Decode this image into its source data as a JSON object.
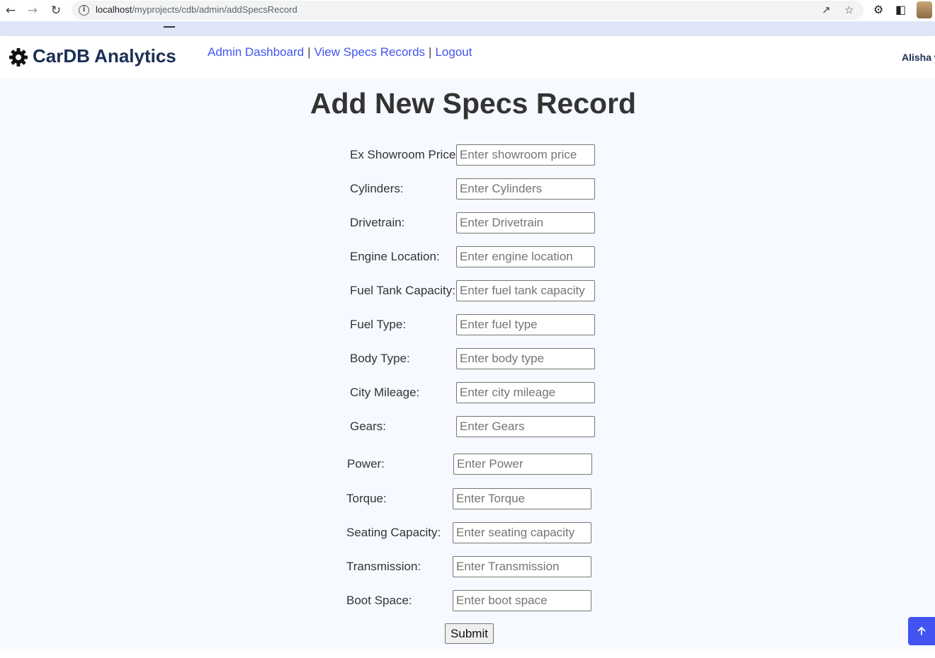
{
  "browser": {
    "url_host": "localhost",
    "url_path": "/myprojects/cdb/admin/addSpecsRecord",
    "icons": [
      "back-arrow-icon",
      "forward-arrow-icon",
      "reload-icon",
      "info-icon",
      "share-icon",
      "star-icon",
      "extensions-icon",
      "side-panel-icon",
      "profile-avatar"
    ]
  },
  "header": {
    "brand": "CarDB Analytics",
    "brand_icon": "gear-icon",
    "nav": {
      "dashboard": "Admin Dashboard",
      "view_specs": "View Specs Records",
      "logout": "Logout",
      "separator": "|"
    },
    "user": "Alisha"
  },
  "page": {
    "title": "Add New Specs Record"
  },
  "form": {
    "fields": [
      {
        "label": "Ex Showroom Price:",
        "placeholder": "Enter showroom price",
        "value": ""
      },
      {
        "label": "Cylinders:",
        "placeholder": "Enter Cylinders",
        "value": ""
      },
      {
        "label": "Drivetrain:",
        "placeholder": "Enter Drivetrain",
        "value": ""
      },
      {
        "label": "Engine Location:",
        "placeholder": "Enter engine location",
        "value": ""
      },
      {
        "label": "Fuel Tank Capacity:",
        "placeholder": "Enter fuel tank capacity",
        "value": ""
      },
      {
        "label": "Fuel Type:",
        "placeholder": "Enter fuel type",
        "value": ""
      },
      {
        "label": "Body Type:",
        "placeholder": "Enter body type",
        "value": ""
      },
      {
        "label": "City Mileage:",
        "placeholder": "Enter city mileage",
        "value": ""
      },
      {
        "label": "Gears:",
        "placeholder": "Enter Gears",
        "value": ""
      },
      {
        "label": "Power:",
        "placeholder": "Enter Power",
        "value": ""
      },
      {
        "label": "Torque:",
        "placeholder": "Enter Torque",
        "value": ""
      },
      {
        "label": "Seating Capacity:",
        "placeholder": "Enter seating capacity",
        "value": ""
      },
      {
        "label": "Transmission:",
        "placeholder": "Enter Transmission",
        "value": ""
      },
      {
        "label": "Boot Space:",
        "placeholder": "Enter boot space",
        "value": ""
      }
    ],
    "submit_label": "Submit"
  },
  "back_to_top_icon": "arrow-up-icon",
  "colors": {
    "accent": "#4154f1",
    "brand_text": "#1a2e55",
    "page_bg": "#f6f9ff"
  }
}
